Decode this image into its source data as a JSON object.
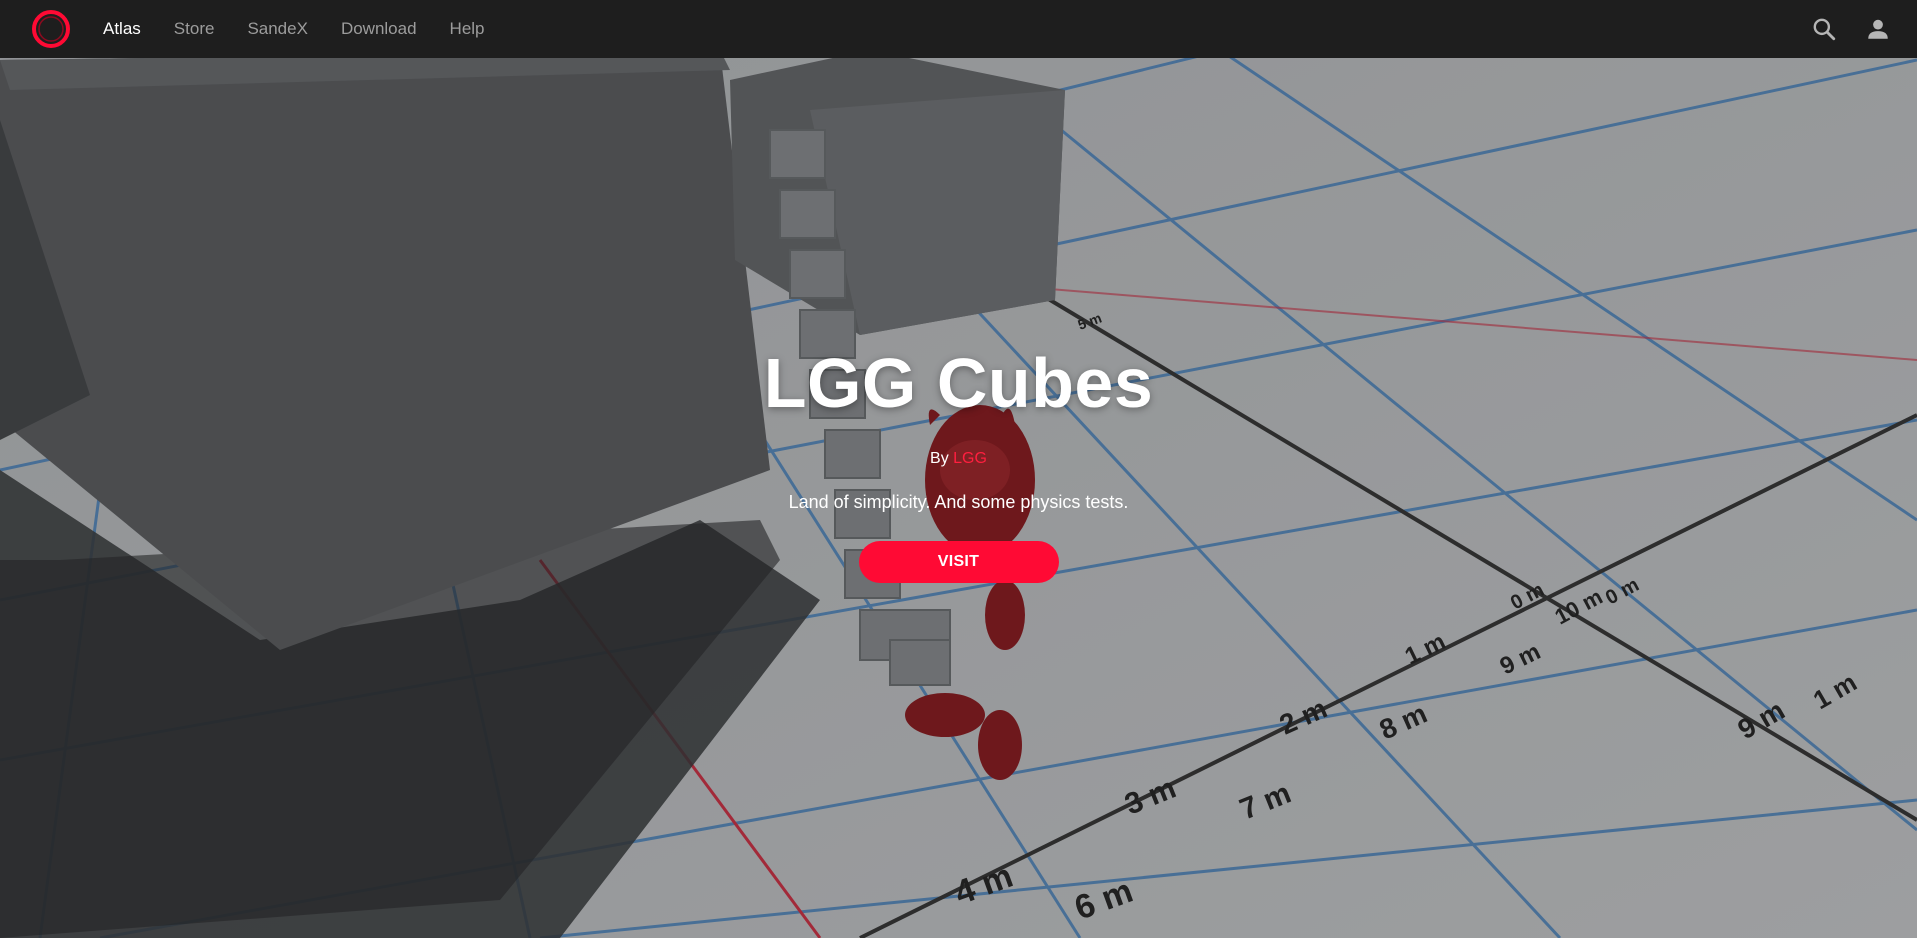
{
  "nav": {
    "logo_icon": "red-ring-logo",
    "items": [
      {
        "label": "Atlas",
        "active": true
      },
      {
        "label": "Store"
      },
      {
        "label": "SandeX"
      },
      {
        "label": "Download"
      },
      {
        "label": "Help"
      }
    ],
    "search_icon": "search-icon",
    "account_icon": "user-icon"
  },
  "hero": {
    "title": "LGG Cubes",
    "by_label": "By",
    "author": "LGG",
    "description": "Land of simplicity. And some physics tests.",
    "visit_label": "VISIT"
  },
  "scene_labels": [
    "4 m",
    "6 m",
    "3 m",
    "7 m",
    "2 m",
    "8 m",
    "1 m",
    "9 m",
    "0 m",
    "10 m",
    "5 m"
  ],
  "colors": {
    "accent": "#ff0a34",
    "topbar": "#1e1e1e",
    "nav_inactive": "#9c9c9c"
  }
}
